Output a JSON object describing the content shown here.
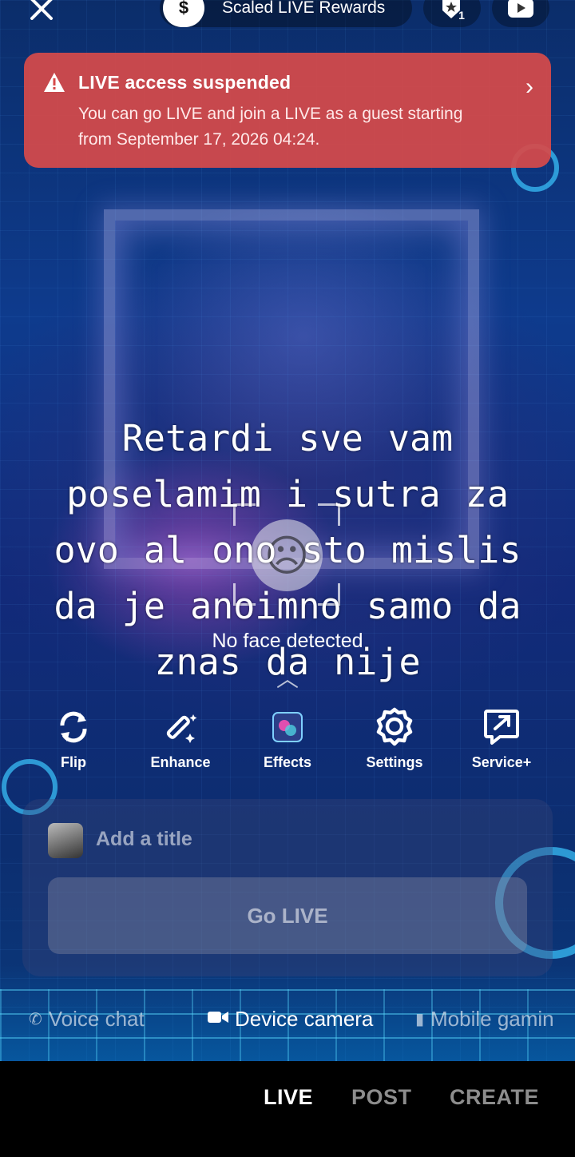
{
  "topbar": {
    "rewards_label": "Scaled LIVE Rewards",
    "rewards_icon": "dollar-coin-icon",
    "badge_count": "1"
  },
  "alert": {
    "title": "LIVE access suspended",
    "body": "You can go LIVE and join a LIVE as a guest starting from September 17, 2026 04:24.",
    "background_color": "#d64a4a"
  },
  "overlay": {
    "text": "Retardi sve vam poselamim i sutra za ovo al ono sto mislis da je anoimno samo da znas  da nije"
  },
  "face_detection": {
    "status": "No face detected"
  },
  "tools": [
    {
      "label": "Flip",
      "icon": "flip-camera-icon"
    },
    {
      "label": "Enhance",
      "icon": "magic-wand-icon"
    },
    {
      "label": "Effects",
      "icon": "effects-icon"
    },
    {
      "label": "Settings",
      "icon": "gear-icon"
    },
    {
      "label": "Service+",
      "icon": "share-arrow-icon"
    }
  ],
  "panel": {
    "title_placeholder": "Add a title",
    "go_live_label": "Go LIVE"
  },
  "modes": {
    "voice_chat": "Voice chat",
    "device_camera": "Device camera",
    "mobile_gaming": "Mobile gamin",
    "active": "Device camera"
  },
  "bottom_nav": {
    "live": "LIVE",
    "post": "POST",
    "create": "CREATE",
    "active": "LIVE"
  }
}
